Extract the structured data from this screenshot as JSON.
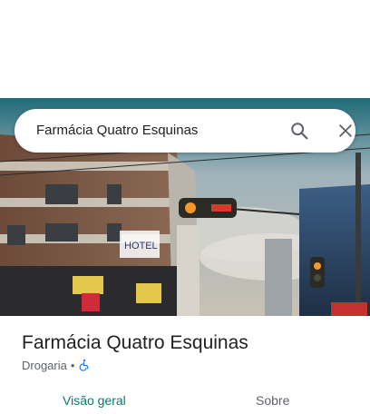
{
  "search": {
    "query": "Farmácia Quatro Esquinas"
  },
  "place": {
    "name": "Farmácia Quatro Esquinas",
    "category": "Drogaria",
    "separator": "•",
    "accessibility_icon": "wheelchair-icon"
  },
  "photo": {
    "sign_text": "HOTEL"
  },
  "tabs": [
    {
      "label": "Visão geral",
      "selected": true
    },
    {
      "label": "Sobre",
      "selected": false
    }
  ],
  "colors": {
    "accent": "#0b7a6f",
    "accessibility_blue": "#1a73e8",
    "text_primary": "#202124",
    "text_secondary": "#5f6368"
  }
}
